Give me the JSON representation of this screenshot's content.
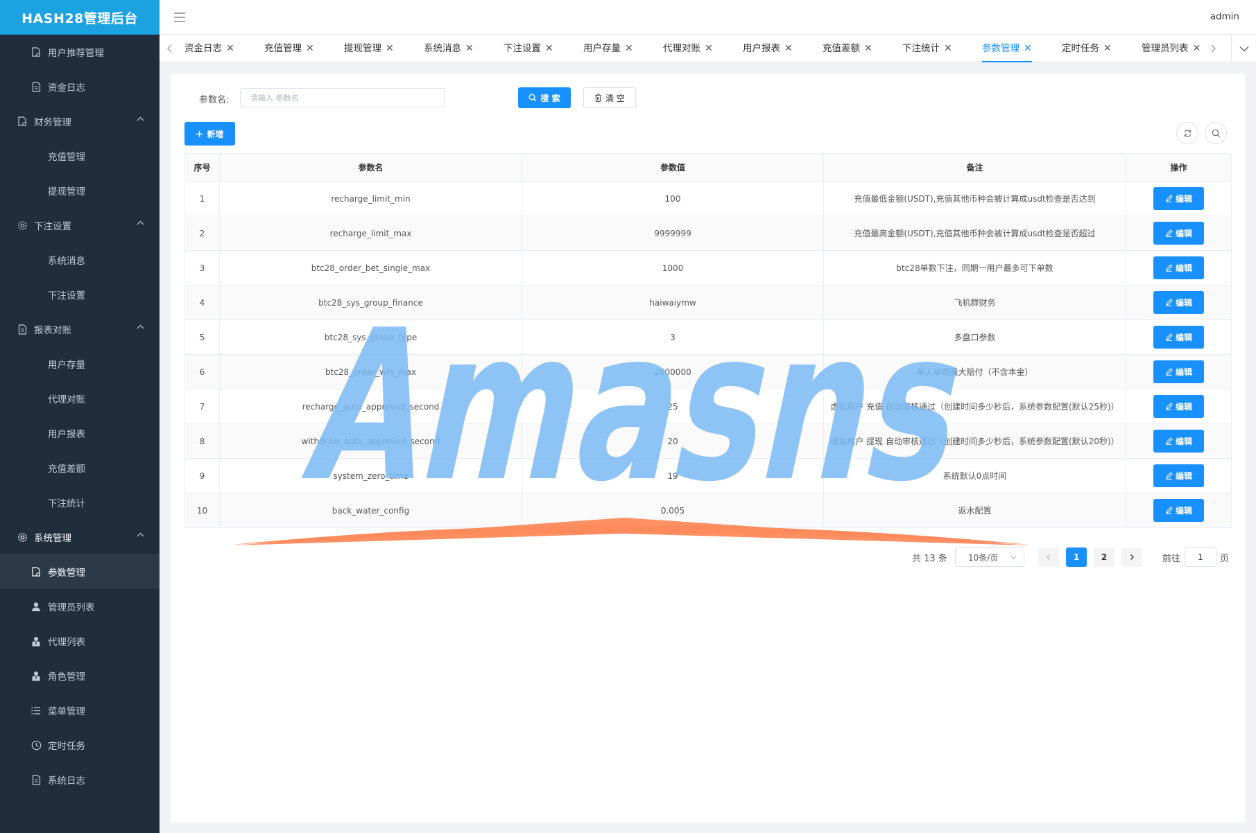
{
  "app": {
    "logo": "HASH28管理后台"
  },
  "header": {
    "user": "admin"
  },
  "sidebar": {
    "items": [
      {
        "label": "用户推荐管理",
        "icon": "doc-settings-icon"
      },
      {
        "label": "资金日志",
        "icon": "document-icon"
      },
      {
        "label": "财务管理",
        "icon": "doc-settings-icon"
      },
      {
        "label": "充值管理"
      },
      {
        "label": "提现管理"
      },
      {
        "label": "下注设置",
        "icon": "gear-icon"
      },
      {
        "label": "系统消息"
      },
      {
        "label": "下注设置"
      },
      {
        "label": "报表对账",
        "icon": "document-icon"
      },
      {
        "label": "用户存量"
      },
      {
        "label": "代理对账"
      },
      {
        "label": "用户报表"
      },
      {
        "label": "充值差额"
      },
      {
        "label": "下注统计"
      },
      {
        "label": "系统管理",
        "icon": "gear-icon"
      },
      {
        "label": "参数管理",
        "icon": "doc-settings-icon"
      },
      {
        "label": "管理员列表",
        "icon": "user-icon"
      },
      {
        "label": "代理列表",
        "icon": "agent-icon"
      },
      {
        "label": "角色管理",
        "icon": "agent-icon"
      },
      {
        "label": "菜单管理",
        "icon": "list-icon"
      },
      {
        "label": "定时任务",
        "icon": "clock-icon"
      },
      {
        "label": "系统日志",
        "icon": "document-icon"
      }
    ]
  },
  "tabs": [
    {
      "label": "资金日志"
    },
    {
      "label": "充值管理"
    },
    {
      "label": "提现管理"
    },
    {
      "label": "系统消息"
    },
    {
      "label": "下注设置"
    },
    {
      "label": "用户存量"
    },
    {
      "label": "代理对账"
    },
    {
      "label": "用户报表"
    },
    {
      "label": "充值差额"
    },
    {
      "label": "下注统计"
    },
    {
      "label": "参数管理",
      "active": true
    },
    {
      "label": "定时任务"
    },
    {
      "label": "管理员列表"
    }
  ],
  "search": {
    "label": "参数名:",
    "placeholder": "请输入 参数名",
    "value": "",
    "search_button": "搜 索",
    "clear_button": "清 空"
  },
  "toolbar": {
    "add_button": "新增"
  },
  "table": {
    "headers": [
      "序号",
      "参数名",
      "参数值",
      "备注",
      "操作"
    ],
    "edit_label": "编辑",
    "rows": [
      {
        "no": "1",
        "name": "recharge_limit_min",
        "value": "100",
        "remark": "充值最低金额(USDT),充值其他币种会被计算成usdt检查是否达到"
      },
      {
        "no": "2",
        "name": "recharge_limit_max",
        "value": "9999999",
        "remark": "充值最高金额(USDT),充值其他币种会被计算成usdt检查是否超过"
      },
      {
        "no": "3",
        "name": "btc28_order_bet_single_max",
        "value": "1000",
        "remark": "btc28单数下注，同期一用户最多可下单数"
      },
      {
        "no": "4",
        "name": "btc28_sys_group_finance",
        "value": "haiwaiymw",
        "remark": "飞机群财务"
      },
      {
        "no": "5",
        "name": "btc28_sys_group_type",
        "value": "3",
        "remark": "多盘口参数"
      },
      {
        "no": "6",
        "name": "btc28_order_win_max",
        "value": "2000000",
        "remark": "单人单期最大赔付（不含本金）"
      },
      {
        "no": "7",
        "name": "recharge_auto_approved_second",
        "value": "25",
        "remark": "虚拟用户 充值 自动审核通过（创建时间多少秒后，系统参数配置(默认25秒)）"
      },
      {
        "no": "8",
        "name": "withdraw_auto_approved_second",
        "value": "20",
        "remark": "虚拟用户 提现 自动审核通过（创建时间多少秒后，系统参数配置(默认20秒)）"
      },
      {
        "no": "9",
        "name": "system_zero_time",
        "value": "19",
        "remark": "系统默认0点时间"
      },
      {
        "no": "10",
        "name": "back_water_config",
        "value": "0.005",
        "remark": "返水配置"
      }
    ]
  },
  "pagination": {
    "total": "共 13 条",
    "page_size": "10条/页",
    "pages": [
      "1",
      "2"
    ],
    "current": "1",
    "goto_label": "前往",
    "goto_value": "1",
    "goto_unit": "页"
  },
  "watermark": {
    "text": "Amasns"
  },
  "colors": {
    "sidebar_bg": "#1f2d3d",
    "logo_bg": "#1ba2e0",
    "primary": "#1890ff",
    "watermark_blue": "#7ab8f5",
    "watermark_orange": "#ff8a5c"
  }
}
